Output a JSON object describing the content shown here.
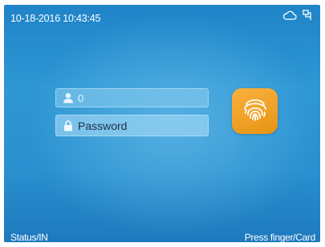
{
  "status_bar": {
    "datetime": "10-18-2016 10:43:45",
    "icons": [
      "cloud-icon",
      "network-icon"
    ]
  },
  "login": {
    "user_id_value": "0",
    "user_icon": "user-icon",
    "password_placeholder": "Password",
    "password_icon": "lock-icon",
    "fingerprint_icon": "fingerprint-icon"
  },
  "footer": {
    "status": "Status/IN",
    "hint": "Press finger/Card"
  },
  "colors": {
    "background": "#2a90cf",
    "accent": "#f0a024",
    "text": "#ffffff"
  }
}
